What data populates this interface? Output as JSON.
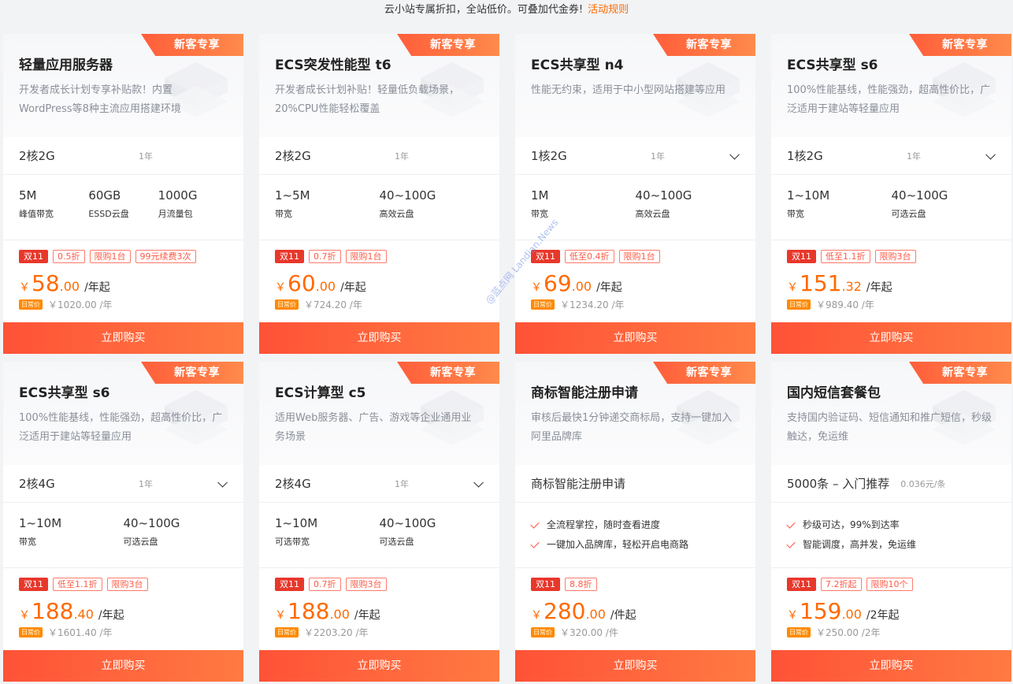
{
  "notice": {
    "text": "云小站专属折扣，全站低价。可叠加代金券!",
    "link": "活动规则"
  },
  "ribbon_label": "新客专享",
  "buy_label": "立即购买",
  "orig_tag_label": "日常价",
  "watermark": "@蓝点网 Landian.News",
  "colors": {
    "accent": "#ff6a00",
    "button": "#ff5237",
    "tag_red": "#e8372b"
  },
  "cards": [
    {
      "title": "轻量应用服务器",
      "desc": "开发者成长计划专享补贴款！内置WordPress等8种主流应用搭建环境",
      "spec": {
        "main": "2核2G",
        "sub": "1年",
        "dropdown": false
      },
      "metrics": [
        {
          "value": "5M",
          "label": "峰值带宽"
        },
        {
          "value": "60GB",
          "label": "ESSD云盘"
        },
        {
          "value": "1000G",
          "label": "月流量包"
        }
      ],
      "tags": [
        "双11",
        "0.5折",
        "限购1台",
        "99元续费3次"
      ],
      "price": {
        "currency": "￥",
        "int": "58",
        "dec": ".00",
        "per": "/年起"
      },
      "orig_price": "￥1020.00 /年"
    },
    {
      "title": "ECS突发性能型 t6",
      "desc": "开发者成长计划补贴！轻量低负载场景，20%CPU性能轻松覆盖",
      "spec": {
        "main": "2核2G",
        "sub": "1年",
        "dropdown": false
      },
      "metrics": [
        {
          "value": "1~5M",
          "label": "带宽"
        },
        {
          "value": "40~100G",
          "label": "高效云盘"
        }
      ],
      "tags": [
        "双11",
        "0.7折",
        "限购1台"
      ],
      "price": {
        "currency": "￥",
        "int": "60",
        "dec": ".00",
        "per": "/年起"
      },
      "orig_price": "￥724.20 /年"
    },
    {
      "title": "ECS共享型 n4",
      "desc": "性能无约束，适用于中小型网站搭建等应用",
      "spec": {
        "main": "1核2G",
        "sub": "1年",
        "dropdown": true
      },
      "metrics": [
        {
          "value": "1M",
          "label": "带宽"
        },
        {
          "value": "40~100G",
          "label": "高效云盘"
        }
      ],
      "tags": [
        "双11",
        "低至0.4折",
        "限购1台"
      ],
      "price": {
        "currency": "￥",
        "int": "69",
        "dec": ".00",
        "per": "/年起"
      },
      "orig_price": "￥1234.20 /年"
    },
    {
      "title": "ECS共享型 s6",
      "desc": "100%性能基线，性能强劲，超高性价比，广泛适用于建站等轻量应用",
      "spec": {
        "main": "1核2G",
        "sub": "1年",
        "dropdown": true
      },
      "metrics": [
        {
          "value": "1~10M",
          "label": "带宽"
        },
        {
          "value": "40~100G",
          "label": "可选云盘"
        }
      ],
      "tags": [
        "双11",
        "低至1.1折",
        "限购3台"
      ],
      "price": {
        "currency": "￥",
        "int": "151",
        "dec": ".32",
        "per": "/年起"
      },
      "orig_price": "￥989.40 /年"
    },
    {
      "title": "ECS共享型 s6",
      "desc": "100%性能基线，性能强劲，超高性价比，广泛适用于建站等轻量应用",
      "spec": {
        "main": "2核4G",
        "sub": "1年",
        "dropdown": true
      },
      "metrics": [
        {
          "value": "1~10M",
          "label": "带宽"
        },
        {
          "value": "40~100G",
          "label": "可选云盘"
        }
      ],
      "tags": [
        "双11",
        "低至1.1折",
        "限购3台"
      ],
      "price": {
        "currency": "￥",
        "int": "188",
        "dec": ".40",
        "per": "/年起"
      },
      "orig_price": "￥1601.40 /年"
    },
    {
      "title": "ECS计算型 c5",
      "desc": "适用Web服务器、广告、游戏等企业通用业务场景",
      "spec": {
        "main": "2核4G",
        "sub": "1年",
        "dropdown": true
      },
      "metrics": [
        {
          "value": "1~10M",
          "label": "可选带宽"
        },
        {
          "value": "40~100G",
          "label": "可选云盘"
        }
      ],
      "tags": [
        "双11",
        "0.7折",
        "限购3台"
      ],
      "price": {
        "currency": "￥",
        "int": "188",
        "dec": ".00",
        "per": "/年起"
      },
      "orig_price": "￥2203.20 /年"
    },
    {
      "title": "商标智能注册申请",
      "desc": "审核后最快1分钟递交商标局，支持一键加入阿里品牌库",
      "spec": {
        "main": "商标智能注册申请",
        "sub": "",
        "dropdown": false,
        "wide": true
      },
      "features": [
        "全流程掌控，随时查看进度",
        "一键加入品牌库，轻松开启电商路"
      ],
      "tags": [
        "双11",
        "8.8折"
      ],
      "price": {
        "currency": "￥",
        "int": "280",
        "dec": ".00",
        "per": "/件起"
      },
      "orig_price": "￥320.00 /件"
    },
    {
      "title": "国内短信套餐包",
      "desc": "支持国内验证码、短信通知和推广短信，秒级触达，免运维",
      "spec": {
        "main": "5000条 – 入门推荐",
        "sub": "0.036元/条",
        "dropdown": false,
        "wide": true
      },
      "features": [
        "秒级可达，99%到达率",
        "智能调度，高并发，免运维"
      ],
      "tags": [
        "双11",
        "7.2折起",
        "限购10个"
      ],
      "price": {
        "currency": "￥",
        "int": "159",
        "dec": ".00",
        "per": "/2年起"
      },
      "orig_price": "￥250.00 /2年"
    }
  ]
}
